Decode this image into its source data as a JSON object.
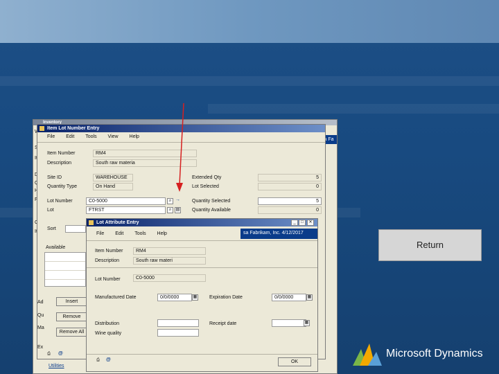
{
  "colors": {
    "titlebar": "#0a246a",
    "return_button": "#d6d6d6",
    "arrow": "#d62020"
  },
  "back_window": {
    "title": "Inventory",
    "labels": [
      "W",
      "S",
      "It",
      "D",
      "Q",
      "H",
      "Fi",
      "C",
      "It"
    ],
    "bottom_label": "Utilities",
    "right_band": "sa Fa"
  },
  "lot_window": {
    "title": "Item Lot Number Entry",
    "menu": [
      "File",
      "Edit",
      "Tools",
      "View",
      "Help"
    ],
    "labels": {
      "item_number": "Item Number",
      "description": "Description",
      "site_id": "Site ID",
      "quantity_type": "Quantity Type",
      "lot_number": "Lot Number",
      "lot": "Lot",
      "extended_qty": "Extended Qty",
      "lot_selected": "Lot Selected",
      "quantity_selected": "Quantity Selected",
      "quantity_available": "Quantity Available",
      "sort": "Sort",
      "available": "Available"
    },
    "values": {
      "item_number": "RM4",
      "description": "South raw materia",
      "site_id": "WAREHOUSE",
      "quantity_type": "On Hand",
      "lot_number": "C0-5000",
      "lot": "FTRST",
      "extended_qty": "5",
      "lot_selected": "0",
      "quantity_selected": "5",
      "quantity_available": "0"
    },
    "buttons": [
      "Insert",
      "Remove",
      "Remove All"
    ],
    "partial_labels": [
      "Ad",
      "Qu",
      "Ma",
      "Ex"
    ]
  },
  "attr_window": {
    "title": "Lot Attribute Entry",
    "menu": [
      "File",
      "Edit",
      "Tools",
      "Help"
    ],
    "user_band": "sa  Fabrikam, Inc.  4/12/2017",
    "labels": {
      "item_number": "Item Number",
      "description": "Description",
      "lot_number": "Lot Number",
      "manufactured_date": "Manufactured Date",
      "expiration_date": "Expiration Date",
      "distribution": "Distribution",
      "wine_quality": "Wine quality",
      "receipt_date": "Receipt date"
    },
    "values": {
      "item_number": "RM4",
      "description": "South raw materi",
      "lot_number": "C0-5000",
      "manufactured_date": "0/0/0000",
      "expiration_date": "0/0/0000"
    },
    "ok_label": "OK"
  },
  "return_button": {
    "label": "Return"
  },
  "brand": {
    "text": "Microsoft Dynamics"
  }
}
